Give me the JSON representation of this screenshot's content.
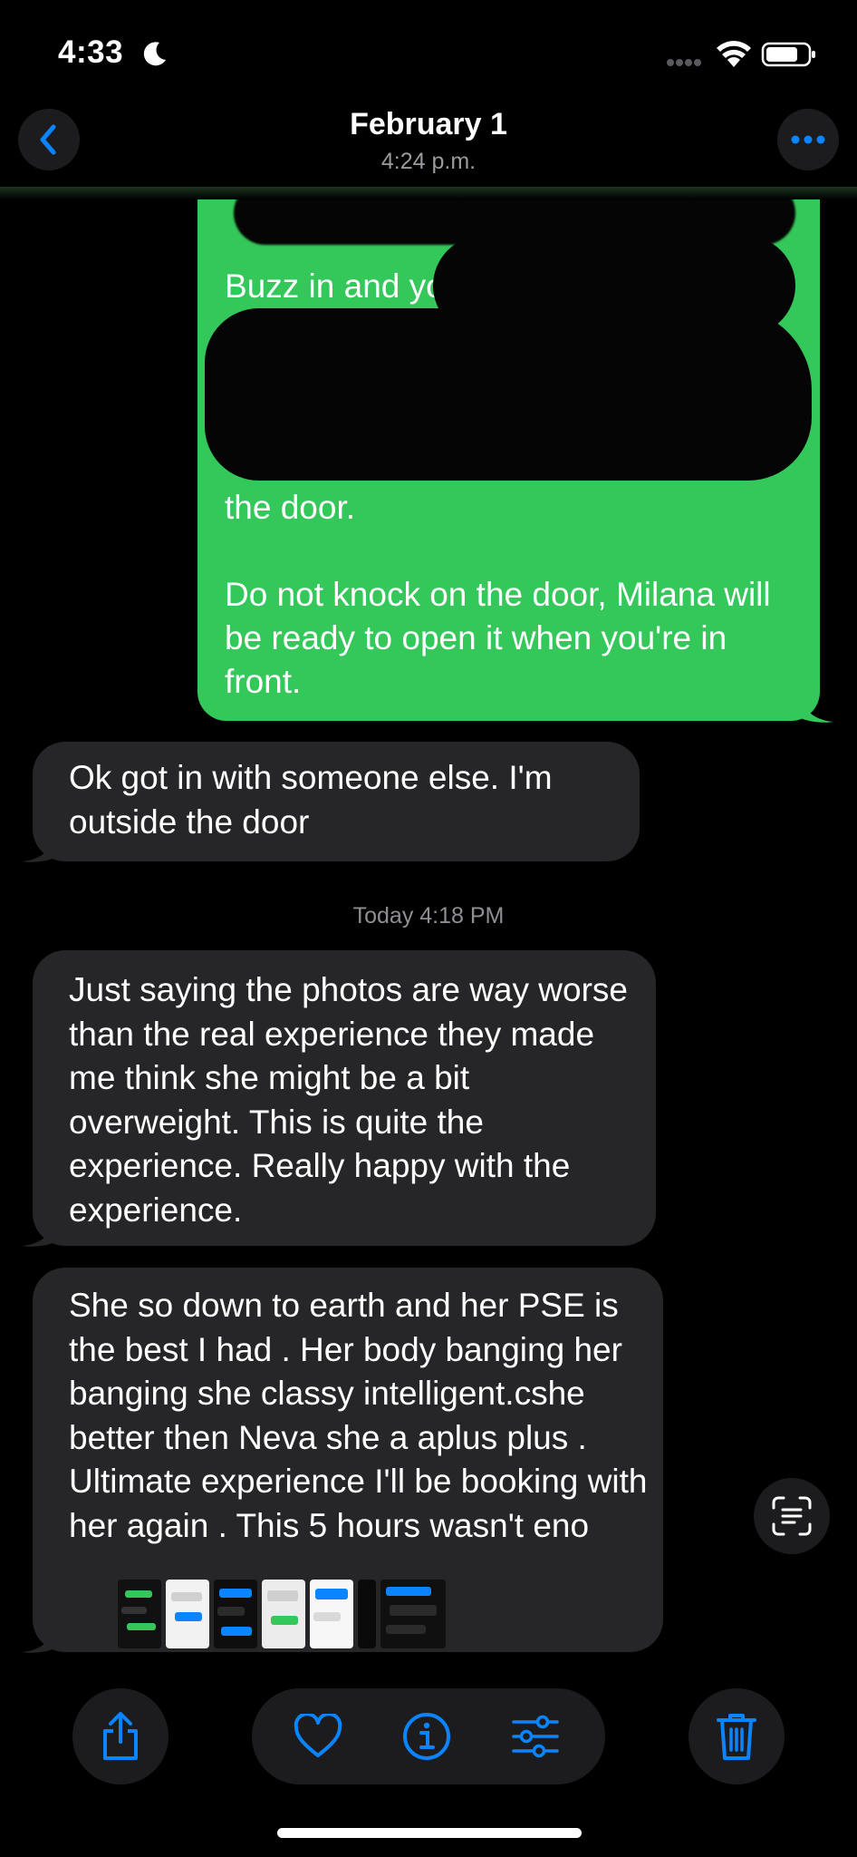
{
  "status_bar": {
    "time": "4:33",
    "icons": [
      "moon-icon",
      "cellular-signal-icon",
      "wifi-icon",
      "battery-icon"
    ]
  },
  "header": {
    "title": "February 1",
    "subtitle": "4:24 p.m.",
    "back_icon": "chevron-left-icon",
    "more_icon": "ellipsis-icon"
  },
  "conversation": {
    "sent_message": {
      "visible_text_top": "Buzz in and yo",
      "visible_text_bottom": "the door.\n\nDo not knock on the door, Milana will be ready to open it when you're in front.",
      "redacted": true
    },
    "received_messages": [
      {
        "text": "Ok got in with someone else. I'm outside the door"
      },
      {
        "text": "Just saying the photos are way worse than the real experience they made me think she might be a bit overweight. This is quite the experience. Really happy with the experience."
      },
      {
        "text": "She so down to earth and her PSE is the best I had . Her body banging her banging she classy intelligent.cshe better then Neva she a aplus plus . Ultimate experience I'll be booking with her again . This 5 hours wasn't eno"
      }
    ],
    "timestamp": "Today 4:18 PM"
  },
  "thumbnails_count": 7,
  "toolbar": {
    "share_icon": "share-icon",
    "favorite_icon": "heart-icon",
    "info_icon": "info-icon",
    "adjust_icon": "sliders-icon",
    "delete_icon": "trash-icon",
    "live_text_icon": "live-text-icon"
  },
  "colors": {
    "accent": "#0a84ff",
    "sent_bubble": "#34c759",
    "received_bubble": "#262628",
    "background": "#000000"
  }
}
